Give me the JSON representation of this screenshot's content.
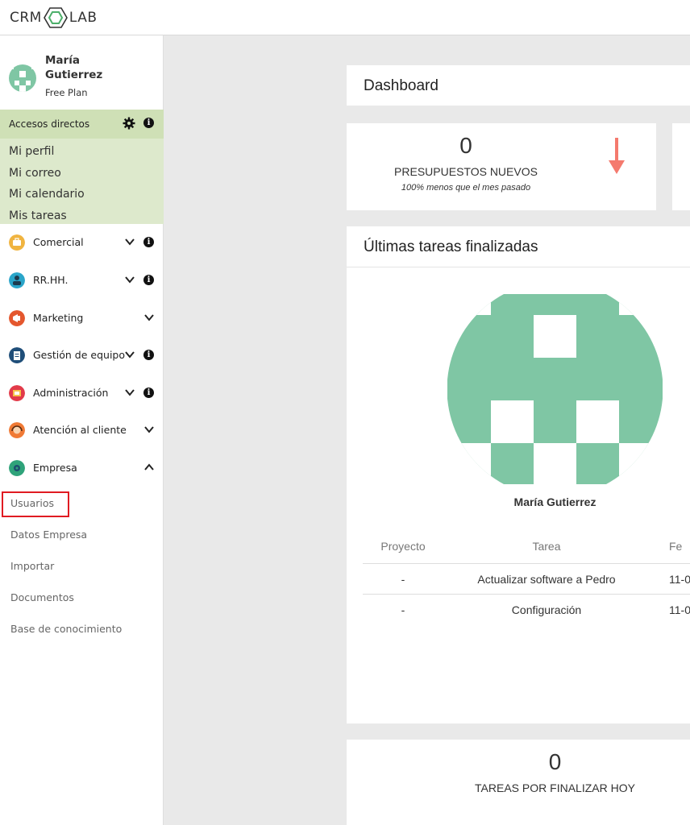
{
  "app": {
    "logo_left": "CRM",
    "logo_right": "LAB"
  },
  "user": {
    "name": "María Gutierrez",
    "plan": "Free Plan"
  },
  "quick_access": {
    "title": "Accesos directos",
    "links": [
      "Mi perfil",
      "Mi correo",
      "Mi calendario",
      "Mis tareas"
    ]
  },
  "menu": [
    {
      "label": "Comercial",
      "icon": "briefcase-icon",
      "color": "#f0b440",
      "expanded": false,
      "info": true
    },
    {
      "label": "RR.HH.",
      "icon": "people-icon",
      "color": "#2aa5c9",
      "expanded": false,
      "info": true
    },
    {
      "label": "Marketing",
      "icon": "megaphone-icon",
      "color": "#e4572e",
      "expanded": false,
      "info": false
    },
    {
      "label": "Gestión de equipo",
      "icon": "clipboard-icon",
      "color": "#1f4e79",
      "expanded": false,
      "info": true
    },
    {
      "label": "Administración",
      "icon": "folder-icon",
      "color": "#e23b4a",
      "expanded": false,
      "info": true
    },
    {
      "label": "Atención al cliente",
      "icon": "headset-icon",
      "color": "#f07a35",
      "expanded": false,
      "info": false
    },
    {
      "label": "Empresa",
      "icon": "gear-icon",
      "color": "#2fa37a",
      "expanded": true,
      "info": false
    }
  ],
  "submenu": [
    "Usuarios",
    "Datos Empresa",
    "Importar",
    "Documentos",
    "Base de conocimiento"
  ],
  "dashboard": {
    "title": "Dashboard"
  },
  "kpi": {
    "value": "0",
    "label": "PRESUPUESTOS NUEVOS",
    "sub": "100% menos que el mes pasado",
    "trend": "down",
    "trend_color": "#f47a6e"
  },
  "tasks": {
    "title": "Últimas tareas finalizadas",
    "user_name": "María Gutierrez",
    "columns": [
      "Proyecto",
      "Tarea",
      "Fe"
    ],
    "rows": [
      [
        "-",
        "Actualizar software a Pedro",
        "11-0"
      ],
      [
        "-",
        "Configuración",
        "11-0"
      ]
    ]
  },
  "pending": {
    "value": "0",
    "label": "TAREAS POR FINALIZAR HOY"
  },
  "colors": {
    "accent_green": "#7fc6a4",
    "quick_bg": "#dde9cc",
    "quick_head": "#cfe0b6",
    "highlight": "#e01b22"
  }
}
